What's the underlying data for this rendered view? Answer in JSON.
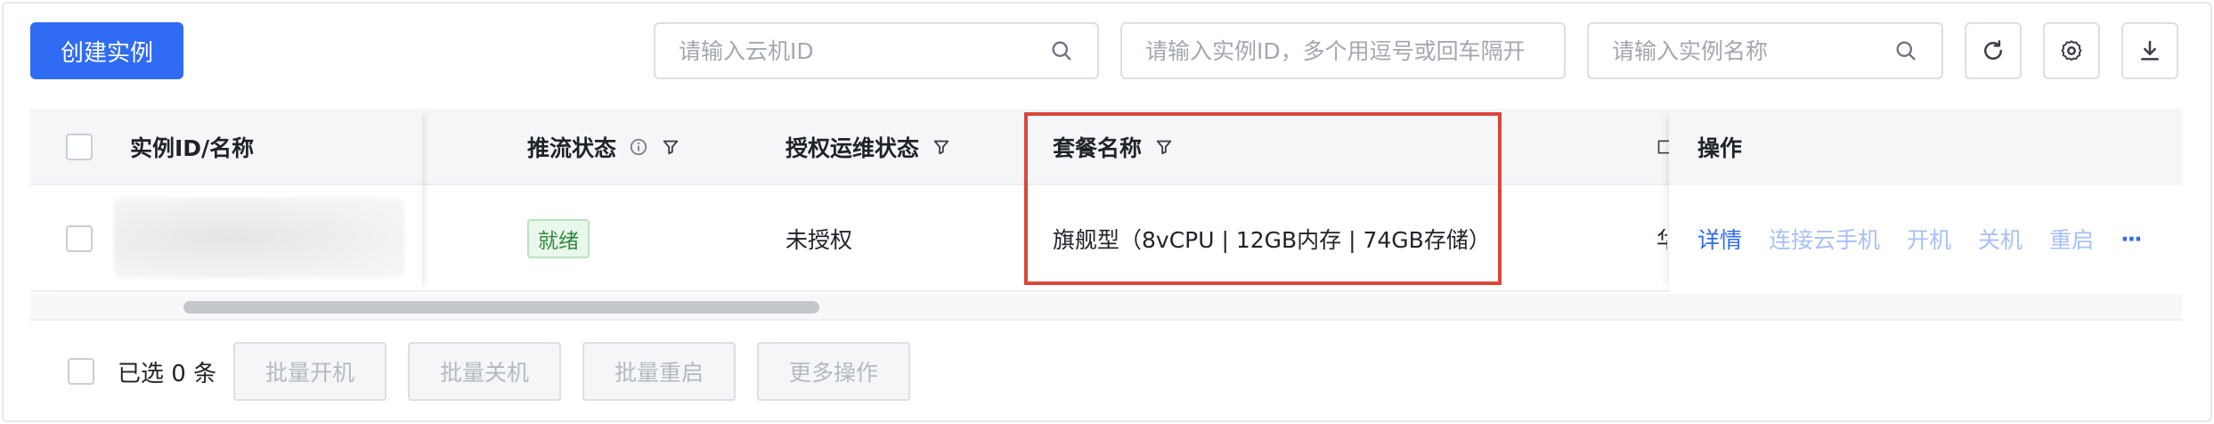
{
  "toolbar": {
    "create_label": "创建实例",
    "search_cloud_id_placeholder": "请输入云机ID",
    "search_instance_ids_placeholder": "请输入实例ID，多个用逗号或回车隔开",
    "search_instance_name_placeholder": "请输入实例名称",
    "icons": [
      "refresh-icon",
      "settings-icon",
      "download-icon"
    ]
  },
  "table": {
    "columns": {
      "id_name": "实例ID/名称",
      "push_status": "推流状态",
      "auth_status": "授权运维状态",
      "package": "套餐名称",
      "actions": "操作"
    },
    "row": {
      "push_status": "就绪",
      "auth_status": "未授权",
      "package": "旗舰型（8vCPU | 12GB内存 | 74GB存储）",
      "actions": [
        "详情",
        "连接云手机",
        "开机",
        "关机",
        "重启"
      ],
      "more": "···"
    }
  },
  "footer": {
    "selected_text": "已选 0 条",
    "buttons": [
      "批量开机",
      "批量关机",
      "批量重启",
      "更多操作"
    ]
  },
  "colors": {
    "primary": "#2f6bf3",
    "highlight": "#d9463b",
    "status_ready": "#2e8b3d"
  }
}
